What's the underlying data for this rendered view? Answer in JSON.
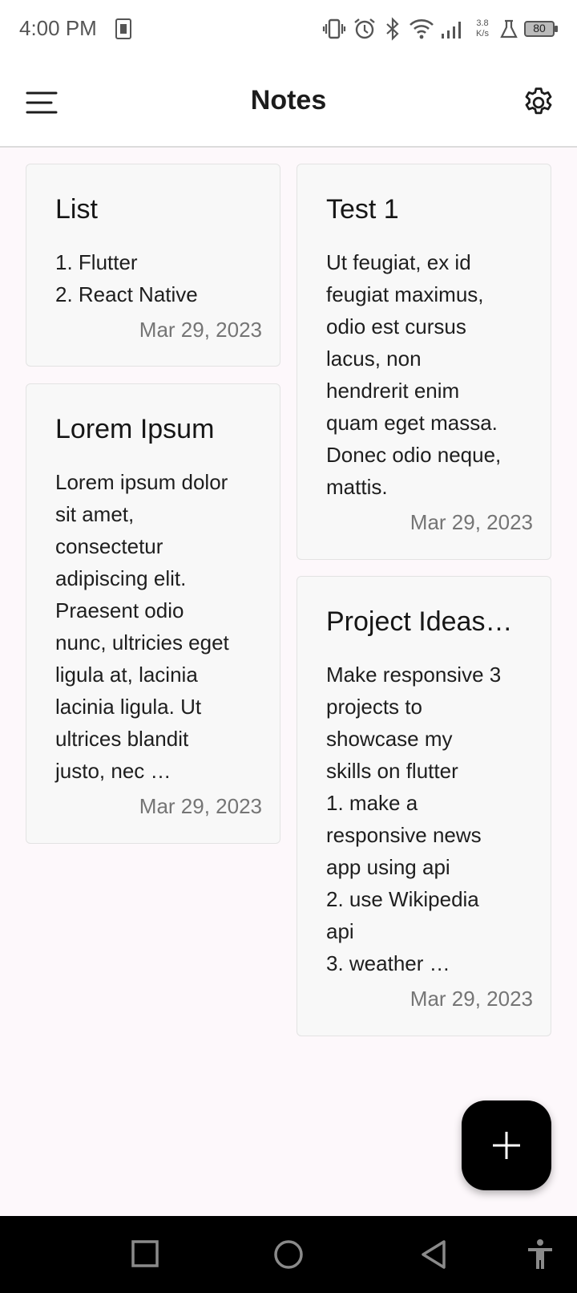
{
  "status_bar": {
    "time": "4:00 PM",
    "net_speed_value": "3.8",
    "net_speed_unit": "K/s",
    "battery": "80",
    "icons": [
      "sim-card-icon",
      "vibrate-icon",
      "alarm-icon",
      "bluetooth-icon",
      "wifi-icon",
      "signal-icon",
      "flask-icon",
      "battery-icon"
    ]
  },
  "app_bar": {
    "title": "Notes",
    "menu_icon": "menu-icon",
    "settings_icon": "gear-icon"
  },
  "notes": [
    {
      "title": "List",
      "body": "1. Flutter\n2. React Native",
      "date": "Mar 29, 2023"
    },
    {
      "title": "Test 1",
      "body": "Ut feugiat, ex id\nfeugiat maximus,\nodio est cursus\nlacus, non\nhendrerit enim\nquam eget massa.\nDonec odio neque,\nmattis.",
      "date": "Mar 29, 2023"
    },
    {
      "title": "Lorem Ipsum",
      "body": "Lorem ipsum dolor\nsit amet,\nconsectetur\nadipiscing elit.\nPraesent odio\nnunc, ultricies eget\nligula at, lacinia\nlacinia ligula. Ut\nultrices blandit\njusto, nec …",
      "date": "Mar 29, 2023"
    },
    {
      "title": "Project Ideas…",
      "body": "Make responsive 3\nprojects to\nshowcase my\nskills on flutter\n1. make a\nresponsive news\napp using api\n2. use Wikipedia\napi\n3. weather …",
      "date": "Mar 29, 2023"
    }
  ],
  "fab": {
    "icon": "plus-icon"
  },
  "nav_bar": {
    "buttons": [
      "recents-square-icon",
      "home-circle-icon",
      "back-triangle-icon",
      "accessibility-icon"
    ]
  },
  "colors": {
    "background": "#fdf8fb",
    "card": "#f8f8f8",
    "fab": "#000000",
    "date_text": "#757575"
  }
}
